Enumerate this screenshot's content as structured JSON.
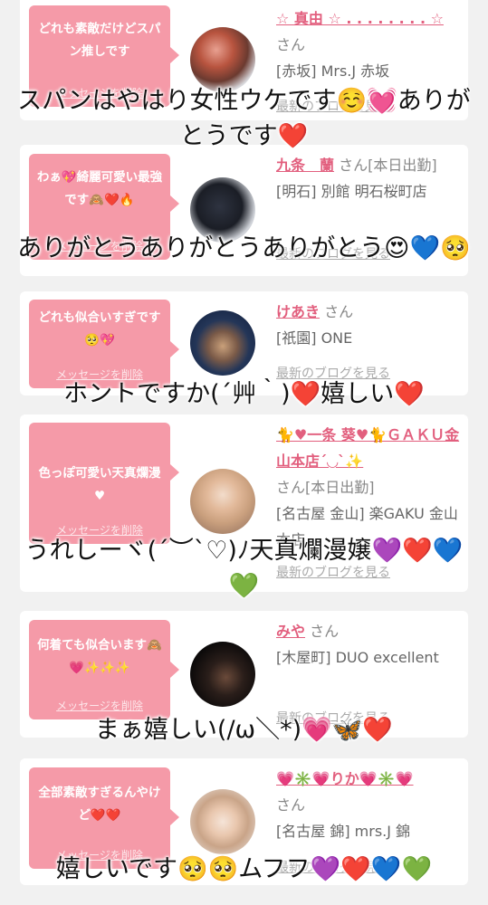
{
  "cards": [
    {
      "message": "どれも素敵だけどスパン推しです",
      "delete_label": "メッセージを削除",
      "name": "☆ 真由 ☆ . . . . . . . . ☆",
      "san": "さん",
      "shop": "[赤坂] Mrs.J 赤坂",
      "blog": "最新のブログを見る",
      "reply": "スパンはやはり女性ウケです☺️💓ありがとうです❤️"
    },
    {
      "message": "わぁ💖綺麗可愛い最強です🙈❤️🔥",
      "delete_label": "メッセージを削除",
      "name": "九条　蘭",
      "san": "さん[本日出勤]",
      "shop": "[明石] 別館 明石桜町店",
      "blog": "最新のブログを見る",
      "reply": "ありがとうありがとうありがとう😍💙🥺"
    },
    {
      "message": "どれも似合いすぎです🥺💖",
      "delete_label": "メッセージを削除",
      "name": "けあき",
      "san": "さん",
      "shop": "[祇園] ONE",
      "blog": "最新のブログを見る",
      "reply": "ホントですか(´艸｀)❤️嬉しい❤️"
    },
    {
      "message": "色っぽ可愛い天真爛漫♥",
      "delete_label": "メッセージを削除",
      "name": "🐈♥一条 葵♥🐈ＧＡＫＵ金山本店´◡`✨",
      "san": "さん[本日出勤]",
      "shop": "[名古屋 金山] 楽GAKU 金山本店",
      "blog": "最新のブログを見る",
      "reply": "うれしーヾ(´︶`♡)ﾉ天真爛漫嬢💜❤️💙💚"
    },
    {
      "message": "何着ても似合います🙈💗✨✨✨",
      "delete_label": "メッセージを削除",
      "name": "みや",
      "san": "さん",
      "shop": "[木屋町] DUO excellent",
      "blog": "最新のブログを見る",
      "reply": "まぁ嬉しい(/ω＼*)💗🦋❤️"
    },
    {
      "message": "全部素敵すぎるんやけど❤️❤️",
      "delete_label": "メッセージを削除",
      "name": "💗✳️💗りか💗✳️💗",
      "san": "さん",
      "shop": "[名古屋 錦] mrs.J 錦",
      "blog": "最新のブログを見る",
      "reply": "嬉しいです🥺🥺ムフフ💜❤️💙💚"
    }
  ],
  "colors": {
    "bubble": "#f59aa8",
    "name": "#e25f7e",
    "page_bg": "#f1f1f1"
  }
}
